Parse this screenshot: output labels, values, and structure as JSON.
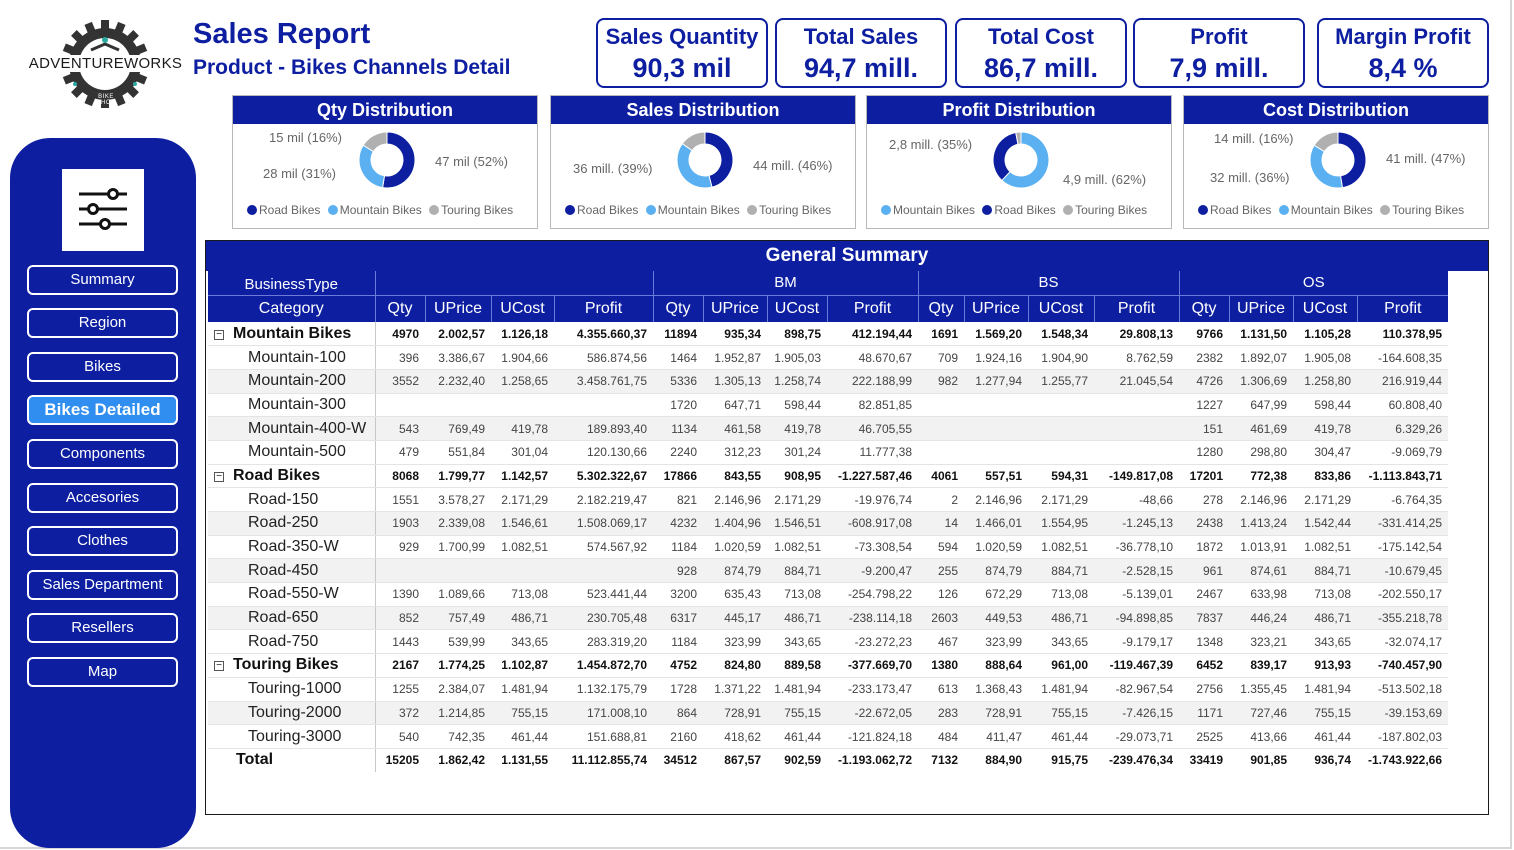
{
  "logo": {
    "name": "ADVENTUREWORKS",
    "sub": "BIKE SHOP"
  },
  "header": {
    "title": "Sales Report",
    "subtitle": "Product - Bikes Channels Detail"
  },
  "kpis": [
    {
      "label": "Sales Quantity",
      "value": "90,3 mil"
    },
    {
      "label": "Total Sales",
      "value": "94,7 mill."
    },
    {
      "label": "Total Cost",
      "value": "86,7 mill."
    },
    {
      "label": "Profit",
      "value": "7,9 mill."
    },
    {
      "label": "Margin Profit",
      "value": "8,4 %"
    }
  ],
  "colors": {
    "road": "#0d1fa0",
    "mountain": "#5ab0f0",
    "touring": "#b0b0b0",
    "brand": "#0d1fa0",
    "active": "#2f8ef0"
  },
  "donuts": [
    {
      "title": "Qty Distribution",
      "labels": [
        "15 mil (16%)",
        "28 mil (31%)",
        "47 mil (52%)"
      ],
      "legend": [
        "Road Bikes",
        "Mountain Bikes",
        "Touring Bikes"
      ],
      "legend_colors": [
        "#0d1fa0",
        "#5ab0f0",
        "#b0b0b0"
      ],
      "slices": [
        {
          "name": "Road Bikes",
          "pct": 52
        },
        {
          "name": "Mountain Bikes",
          "pct": 31
        },
        {
          "name": "Touring Bikes",
          "pct": 16
        }
      ]
    },
    {
      "title": "Sales Distribution",
      "labels": [
        "36 mill. (39%)",
        "44 mill. (46%)"
      ],
      "legend": [
        "Road Bikes",
        "Mountain Bikes",
        "Touring Bikes"
      ],
      "legend_colors": [
        "#0d1fa0",
        "#5ab0f0",
        "#b0b0b0"
      ],
      "slices": [
        {
          "name": "Road Bikes",
          "pct": 46
        },
        {
          "name": "Mountain Bikes",
          "pct": 39
        },
        {
          "name": "Touring Bikes",
          "pct": 15
        }
      ]
    },
    {
      "title": "Profit Distribution",
      "labels": [
        "2,8 mill. (35%)",
        "4,9 mill. (62%)"
      ],
      "legend": [
        "Mountain Bikes",
        "Road Bikes",
        "Touring Bikes"
      ],
      "legend_colors": [
        "#5ab0f0",
        "#0d1fa0",
        "#b0b0b0"
      ],
      "slices": [
        {
          "name": "Mountain Bikes",
          "pct": 62
        },
        {
          "name": "Road Bikes",
          "pct": 35
        },
        {
          "name": "Touring Bikes",
          "pct": 3
        }
      ]
    },
    {
      "title": "Cost Distribution",
      "labels": [
        "14 mill. (16%)",
        "32 mill. (36%)",
        "41 mill. (47%)"
      ],
      "legend": [
        "Road Bikes",
        "Mountain Bikes",
        "Touring Bikes"
      ],
      "legend_colors": [
        "#0d1fa0",
        "#5ab0f0",
        "#b0b0b0"
      ],
      "slices": [
        {
          "name": "Road Bikes",
          "pct": 47
        },
        {
          "name": "Mountain Bikes",
          "pct": 36
        },
        {
          "name": "Touring Bikes",
          "pct": 16
        }
      ]
    }
  ],
  "nav": {
    "filter_icon": "sliders-icon",
    "items": [
      "Summary",
      "Region",
      "Bikes",
      "Bikes Detailed",
      "Components",
      "Accesories",
      "Clothes",
      "Sales Department",
      "Resellers",
      "Map"
    ],
    "active": "Bikes Detailed"
  },
  "matrix": {
    "title": "General Summary",
    "business_type_label": "BusinessType",
    "category_label": "Category",
    "groups": [
      "",
      "BM",
      "BS",
      "OS"
    ],
    "columns": [
      "Qty",
      "UPrice",
      "UCost",
      "Profit"
    ],
    "rows": [
      {
        "type": "group",
        "name": "Mountain Bikes",
        "values": [
          "4970",
          "2.002,57",
          "1.126,18",
          "4.355.660,37",
          "11894",
          "935,34",
          "898,75",
          "412.194,44",
          "1691",
          "1.569,20",
          "1.548,34",
          "29.808,13",
          "9766",
          "1.131,50",
          "1.105,28",
          "110.378,95"
        ]
      },
      {
        "type": "item",
        "name": "Mountain-100",
        "values": [
          "396",
          "3.386,67",
          "1.904,66",
          "586.874,56",
          "1464",
          "1.952,87",
          "1.905,03",
          "48.670,67",
          "709",
          "1.924,16",
          "1.904,90",
          "8.762,59",
          "2382",
          "1.892,07",
          "1.905,08",
          "-164.608,35"
        ]
      },
      {
        "type": "item",
        "name": "Mountain-200",
        "values": [
          "3552",
          "2.232,40",
          "1.258,65",
          "3.458.761,75",
          "5336",
          "1.305,13",
          "1.258,74",
          "222.188,99",
          "982",
          "1.277,94",
          "1.255,77",
          "21.045,54",
          "4726",
          "1.306,69",
          "1.258,80",
          "216.919,44"
        ]
      },
      {
        "type": "item",
        "name": "Mountain-300",
        "values": [
          "",
          "",
          "",
          "",
          "1720",
          "647,71",
          "598,44",
          "82.851,85",
          "",
          "",
          "",
          "",
          "1227",
          "647,99",
          "598,44",
          "60.808,40"
        ]
      },
      {
        "type": "item",
        "name": "Mountain-400-W",
        "values": [
          "543",
          "769,49",
          "419,78",
          "189.893,40",
          "1134",
          "461,58",
          "419,78",
          "46.705,55",
          "",
          "",
          "",
          "",
          "151",
          "461,69",
          "419,78",
          "6.329,26"
        ]
      },
      {
        "type": "item",
        "name": "Mountain-500",
        "values": [
          "479",
          "551,84",
          "301,04",
          "120.130,66",
          "2240",
          "312,23",
          "301,24",
          "11.777,38",
          "",
          "",
          "",
          "",
          "1280",
          "298,80",
          "304,47",
          "-9.069,79"
        ]
      },
      {
        "type": "group",
        "name": "Road Bikes",
        "values": [
          "8068",
          "1.799,77",
          "1.142,57",
          "5.302.322,67",
          "17866",
          "843,55",
          "908,95",
          "-1.227.587,46",
          "4061",
          "557,51",
          "594,31",
          "-149.817,08",
          "17201",
          "772,38",
          "833,86",
          "-1.113.843,71"
        ]
      },
      {
        "type": "item",
        "name": "Road-150",
        "values": [
          "1551",
          "3.578,27",
          "2.171,29",
          "2.182.219,47",
          "821",
          "2.146,96",
          "2.171,29",
          "-19.976,74",
          "2",
          "2.146,96",
          "2.171,29",
          "-48,66",
          "278",
          "2.146,96",
          "2.171,29",
          "-6.764,35"
        ]
      },
      {
        "type": "item",
        "name": "Road-250",
        "values": [
          "1903",
          "2.339,08",
          "1.546,61",
          "1.508.069,17",
          "4232",
          "1.404,96",
          "1.546,51",
          "-608.917,08",
          "14",
          "1.466,01",
          "1.554,95",
          "-1.245,13",
          "2438",
          "1.413,24",
          "1.542,44",
          "-331.414,25"
        ]
      },
      {
        "type": "item",
        "name": "Road-350-W",
        "values": [
          "929",
          "1.700,99",
          "1.082,51",
          "574.567,92",
          "1184",
          "1.020,59",
          "1.082,51",
          "-73.308,54",
          "594",
          "1.020,59",
          "1.082,51",
          "-36.778,10",
          "1872",
          "1.013,91",
          "1.082,51",
          "-175.142,54"
        ]
      },
      {
        "type": "item",
        "name": "Road-450",
        "values": [
          "",
          "",
          "",
          "",
          "928",
          "874,79",
          "884,71",
          "-9.200,47",
          "255",
          "874,79",
          "884,71",
          "-2.528,15",
          "961",
          "874,61",
          "884,71",
          "-10.679,45"
        ]
      },
      {
        "type": "item",
        "name": "Road-550-W",
        "values": [
          "1390",
          "1.089,66",
          "713,08",
          "523.441,44",
          "3200",
          "635,43",
          "713,08",
          "-254.798,22",
          "126",
          "672,29",
          "713,08",
          "-5.139,01",
          "2467",
          "633,98",
          "713,08",
          "-202.550,17"
        ]
      },
      {
        "type": "item",
        "name": "Road-650",
        "values": [
          "852",
          "757,49",
          "486,71",
          "230.705,48",
          "6317",
          "445,17",
          "486,71",
          "-238.114,18",
          "2603",
          "449,53",
          "486,71",
          "-94.898,85",
          "7837",
          "446,24",
          "486,71",
          "-355.218,78"
        ]
      },
      {
        "type": "item",
        "name": "Road-750",
        "values": [
          "1443",
          "539,99",
          "343,65",
          "283.319,20",
          "1184",
          "323,99",
          "343,65",
          "-23.272,23",
          "467",
          "323,99",
          "343,65",
          "-9.179,17",
          "1348",
          "323,21",
          "343,65",
          "-32.074,17"
        ]
      },
      {
        "type": "group",
        "name": "Touring Bikes",
        "values": [
          "2167",
          "1.774,25",
          "1.102,87",
          "1.454.872,70",
          "4752",
          "824,80",
          "889,58",
          "-377.669,70",
          "1380",
          "888,64",
          "961,00",
          "-119.467,39",
          "6452",
          "839,17",
          "913,93",
          "-740.457,90"
        ]
      },
      {
        "type": "item",
        "name": "Touring-1000",
        "values": [
          "1255",
          "2.384,07",
          "1.481,94",
          "1.132.175,79",
          "1728",
          "1.371,22",
          "1.481,94",
          "-233.173,47",
          "613",
          "1.368,43",
          "1.481,94",
          "-82.967,54",
          "2756",
          "1.355,45",
          "1.481,94",
          "-513.502,18"
        ]
      },
      {
        "type": "item",
        "name": "Touring-2000",
        "values": [
          "372",
          "1.214,85",
          "755,15",
          "171.008,10",
          "864",
          "728,91",
          "755,15",
          "-22.672,05",
          "283",
          "728,91",
          "755,15",
          "-7.426,15",
          "1171",
          "727,46",
          "755,15",
          "-39.153,69"
        ]
      },
      {
        "type": "item",
        "name": "Touring-3000",
        "values": [
          "540",
          "742,35",
          "461,44",
          "151.688,81",
          "2160",
          "418,62",
          "461,44",
          "-121.824,18",
          "484",
          "411,47",
          "461,44",
          "-29.073,71",
          "2525",
          "413,66",
          "461,44",
          "-187.802,03"
        ]
      },
      {
        "type": "total",
        "name": "Total",
        "values": [
          "15205",
          "1.862,42",
          "1.131,55",
          "11.112.855,74",
          "34512",
          "867,57",
          "902,59",
          "-1.193.062,72",
          "7132",
          "884,90",
          "915,75",
          "-239.476,34",
          "33419",
          "901,85",
          "936,74",
          "-1.743.922,66"
        ]
      }
    ]
  }
}
